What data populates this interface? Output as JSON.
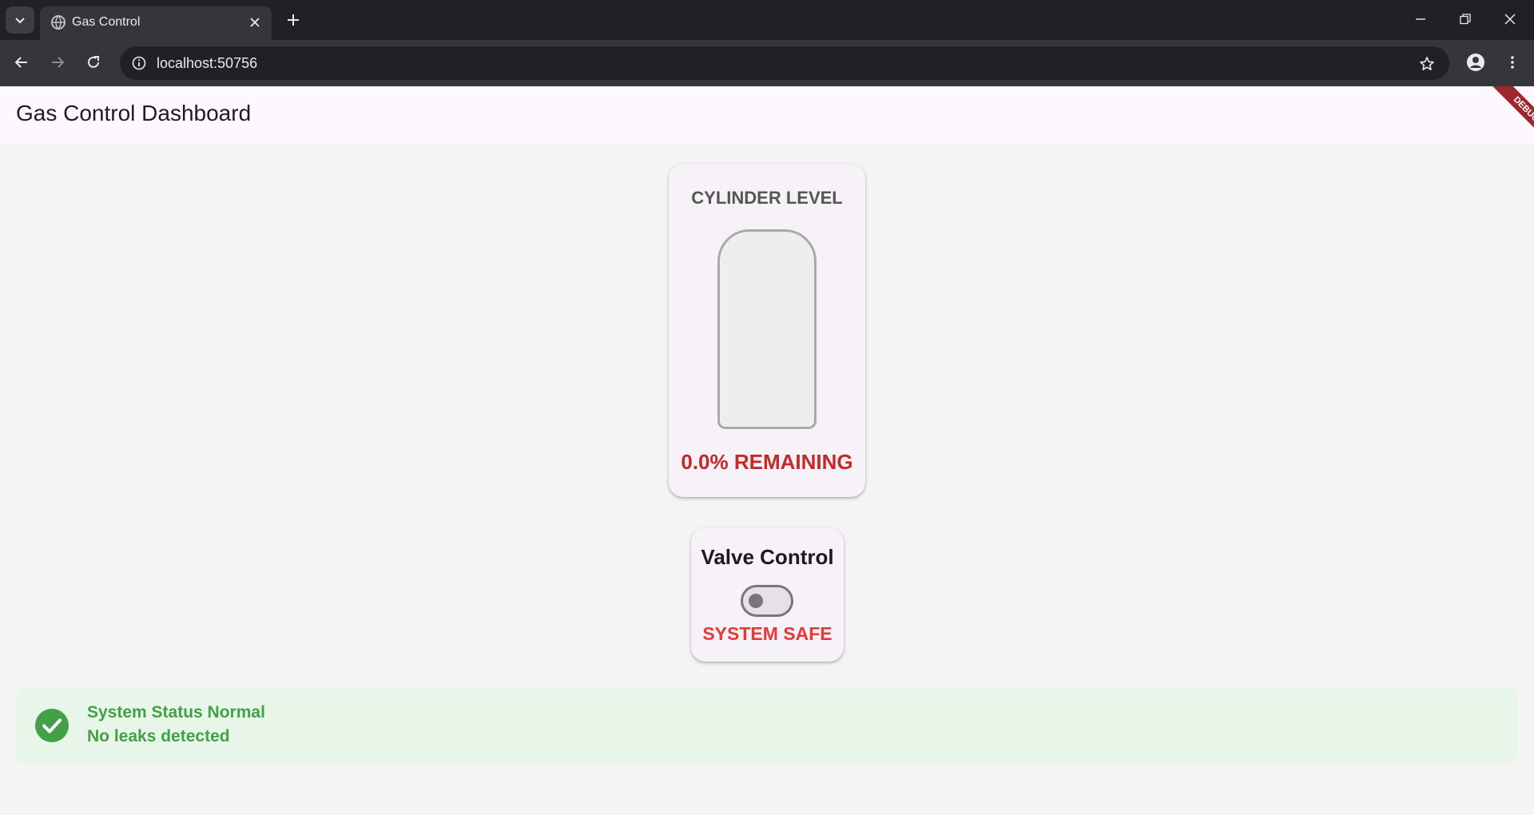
{
  "browser": {
    "tab_title": "Gas Control",
    "url": "localhost:50756"
  },
  "app": {
    "title": "Gas Control Dashboard",
    "debug_label": "DEBUG"
  },
  "cylinder": {
    "title": "CYLINDER LEVEL",
    "level_percent": 0.0,
    "remaining_text": "0.0% REMAINING"
  },
  "valve": {
    "title": "Valve Control",
    "switch_on": false,
    "status_text": "SYSTEM SAFE"
  },
  "status": {
    "line1": "System Status Normal",
    "line2": "No leaks detected",
    "color": "#43a047"
  },
  "colors": {
    "remaining": "#c62828",
    "safe": "#e53935"
  }
}
